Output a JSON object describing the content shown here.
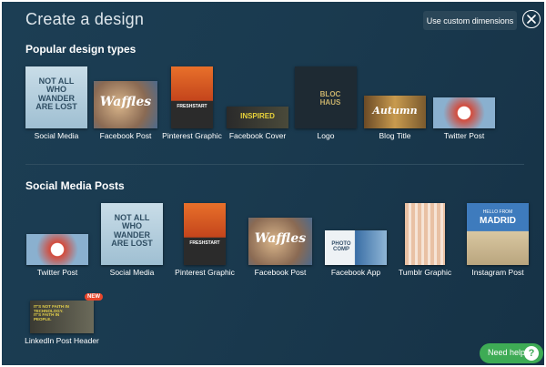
{
  "header": {
    "title": "Create a design",
    "custom_dimensions": "Use custom dimensions"
  },
  "popular": {
    "heading": "Popular design types",
    "items": [
      {
        "label": "Social Media"
      },
      {
        "label": "Facebook Post"
      },
      {
        "label": "Pinterest Graphic"
      },
      {
        "label": "Facebook Cover"
      },
      {
        "label": "Logo"
      },
      {
        "label": "Blog Title"
      },
      {
        "label": "Twitter Post"
      }
    ]
  },
  "social": {
    "heading": "Social Media Posts",
    "items": [
      {
        "label": "Twitter Post"
      },
      {
        "label": "Social Media"
      },
      {
        "label": "Pinterest Graphic"
      },
      {
        "label": "Facebook Post"
      },
      {
        "label": "Facebook App"
      },
      {
        "label": "Tumblr Graphic"
      },
      {
        "label": "Instagram Post"
      },
      {
        "label": "LinkedIn Post Header"
      }
    ]
  },
  "thumb_text": {
    "wander": "NOT ALL WHO WANDER ARE LOST",
    "waffles": "Waffles",
    "freshstart": "FRESHSTART",
    "inspired": "INSPIRED",
    "bloc": "BLOC",
    "haus": "HAUS",
    "autumn": "Autumn",
    "photocomp": "PHOTO COMP",
    "hellofrom": "HELLO FROM",
    "madrid": "MADRID",
    "linkedin_text": "IT'S NOT FAITH IN TECHNOLOGY. IT'S FAITH IN PEOPLE."
  },
  "badge": {
    "new": "NEW"
  },
  "help": {
    "label": "Need help",
    "q": "?"
  },
  "colors": {
    "background": "#1b3b50",
    "help_green": "#3eab55",
    "badge_red": "#e8462b"
  }
}
